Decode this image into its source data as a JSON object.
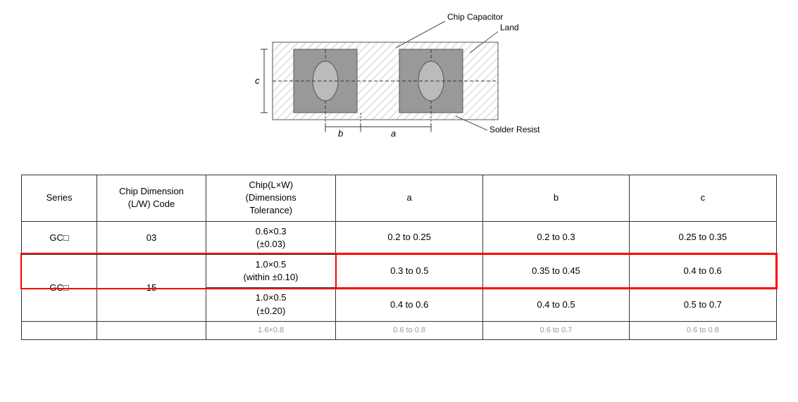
{
  "diagram": {
    "chip_capacitor_label": "Chip Capacitor",
    "land_label": "Land",
    "solder_resist_label": "Solder Resist",
    "label_c": "c",
    "label_b": "b",
    "label_a": "a"
  },
  "table": {
    "headers": {
      "series": "Series",
      "chip_dimension": "Chip  Dimension",
      "chip_dimension2": "(L/W)  Code",
      "chip_lwt": "Chip(L×W)",
      "chip_lwt2": "(Dimensions",
      "chip_lwt3": "Tolerance)",
      "col_a": "a",
      "col_b": "b",
      "col_c": "c"
    },
    "rows": [
      {
        "series": "GC□",
        "code": "03",
        "chip_dim": "0.6×0.3",
        "chip_tol": "(±0.03)",
        "a": "0.2 to 0.25",
        "b": "0.2 to 0.3",
        "c": "0.25 to 0.35",
        "highlight": false
      },
      {
        "series": "GC□",
        "code": "15",
        "chip_dim": "1.0×0.5",
        "chip_tol": "(within ±0.10)",
        "a": "0.3 to 0.5",
        "b": "0.35 to 0.45",
        "c": "0.4 to 0.6",
        "highlight": true
      },
      {
        "series": "",
        "code": "",
        "chip_dim": "1.0×0.5",
        "chip_tol": "(±0.20)",
        "a": "0.4 to 0.6",
        "b": "0.4 to 0.5",
        "c": "0.5 to 0.7",
        "highlight": false
      },
      {
        "series": "",
        "code": "",
        "chip_dim": "1.6×0.8",
        "chip_tol": "",
        "a": "0.6 to 0.8",
        "b": "0.6 to 0.7",
        "c": "0.6 to 0.8",
        "partial": true,
        "highlight": false
      }
    ]
  }
}
